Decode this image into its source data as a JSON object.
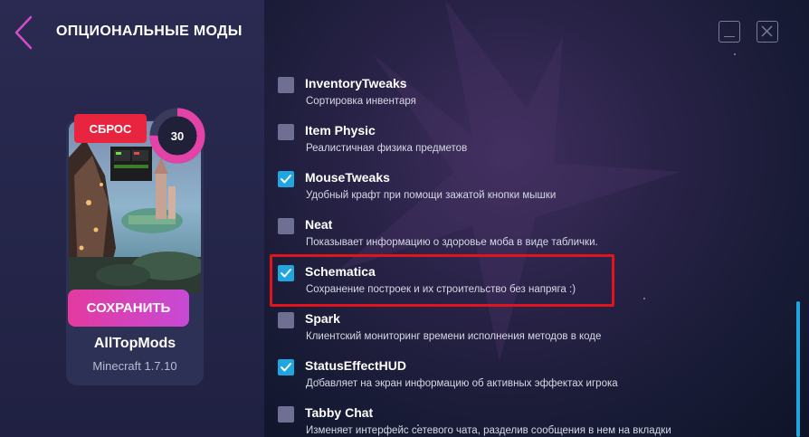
{
  "header": {
    "title": "ОПЦИОНАЛЬНЫЕ МОДЫ",
    "back_icon": "chevron-left-icon",
    "minimize_icon": "minimize-icon",
    "close_icon": "close-icon"
  },
  "pack": {
    "reset_label": "СБРОС",
    "mod_count": "30",
    "mod_count_fraction": 0.75,
    "save_label": "СОХРАНИТЬ",
    "name": "AllTopMods",
    "version": "Minecraft 1.7.10"
  },
  "mods": [
    {
      "name": "InventoryTweaks",
      "description": "Сортировка инвентаря",
      "checked": false
    },
    {
      "name": "Item Physic",
      "description": "Реалистичная физика предметов",
      "checked": false
    },
    {
      "name": "MouseTweaks",
      "description": "Удобный крафт при помощи зажатой кнопки мышки",
      "checked": true
    },
    {
      "name": "Neat",
      "description": "Показывает информацию о здоровье моба в виде таблички.",
      "checked": false
    },
    {
      "name": "Schematica",
      "description": "Сохранение построек и их строительство без напряга :)",
      "checked": true
    },
    {
      "name": "Spark",
      "description": "Клиентский мониторинг времени исполнения методов в коде",
      "checked": false
    },
    {
      "name": "StatusEffectHUD",
      "description": "Добавляет на экран информацию об активных эффектах игрока",
      "checked": true
    },
    {
      "name": "Tabby Chat",
      "description": "Изменяет интерфейс сетевого чата, разделив сообщения в нем на вкладки",
      "checked": false
    }
  ],
  "colors": {
    "accent_blue": "#1fa6e0",
    "reset_red": "#e8243f",
    "save_pink": "#e33aa0",
    "highlight_red": "#e0141c",
    "counter_ring": "#e342a6"
  }
}
